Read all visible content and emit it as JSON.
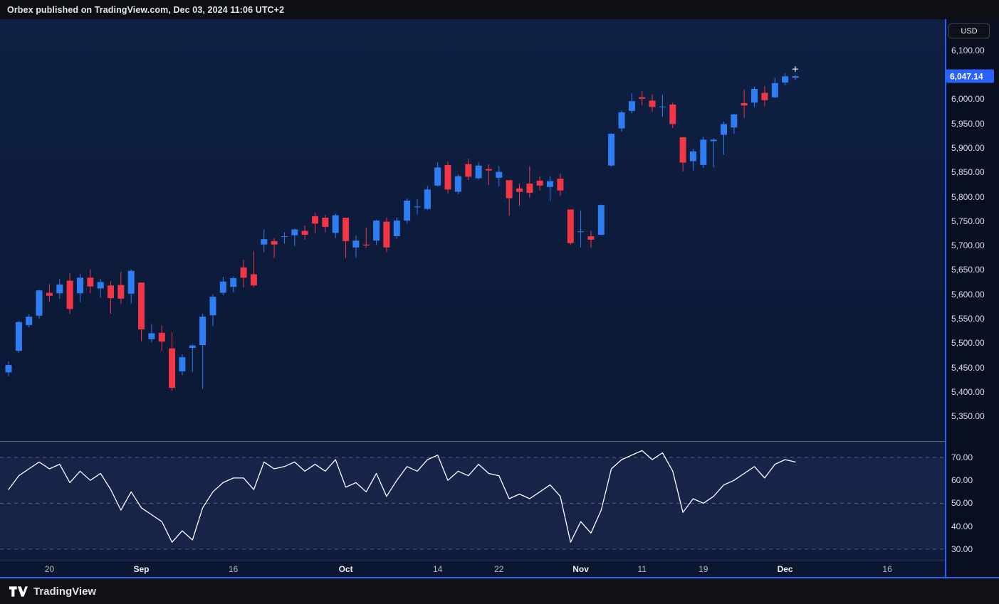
{
  "banner": {
    "text": "Orbex published on TradingView.com, Dec 03, 2024 11:06 UTC+2"
  },
  "footer": {
    "brand": "TradingView"
  },
  "price_axis": {
    "currency_label": "USD",
    "last_price_badge": "6,047.14"
  },
  "time_axis": {
    "ticks": [
      {
        "label": "20",
        "index": 4,
        "major": false
      },
      {
        "label": "Sep",
        "index": 13,
        "major": true
      },
      {
        "label": "16",
        "index": 22,
        "major": false
      },
      {
        "label": "Oct",
        "index": 33,
        "major": true
      },
      {
        "label": "14",
        "index": 42,
        "major": false
      },
      {
        "label": "22",
        "index": 48,
        "major": false
      },
      {
        "label": "Nov",
        "index": 56,
        "major": true
      },
      {
        "label": "11",
        "index": 62,
        "major": false
      },
      {
        "label": "19",
        "index": 68,
        "major": false
      },
      {
        "label": "Dec",
        "index": 76,
        "major": true
      },
      {
        "label": "16",
        "index": 86,
        "major": false
      }
    ]
  },
  "colors": {
    "up": "#2f7df2",
    "down": "#f23645",
    "accent": "#2962ff",
    "rsi_line": "#ffffff",
    "background": "#0c1a38"
  },
  "chart_data": [
    {
      "type": "candlestick",
      "name": "price",
      "currency": "USD",
      "last_price": 6047.14,
      "y_range": [
        5299,
        6164
      ],
      "y_axis_ticks": [
        {
          "label": "6,100.00",
          "value": 6100
        },
        {
          "label": "6,000.00",
          "value": 6000
        },
        {
          "label": "5,950.00",
          "value": 5950
        },
        {
          "label": "5,900.00",
          "value": 5900
        },
        {
          "label": "5,850.00",
          "value": 5850
        },
        {
          "label": "5,800.00",
          "value": 5800
        },
        {
          "label": "5,750.00",
          "value": 5750
        },
        {
          "label": "5,700.00",
          "value": 5700
        },
        {
          "label": "5,650.00",
          "value": 5650
        },
        {
          "label": "5,600.00",
          "value": 5600
        },
        {
          "label": "5,550.00",
          "value": 5550
        },
        {
          "label": "5,500.00",
          "value": 5500
        },
        {
          "label": "5,450.00",
          "value": 5450
        },
        {
          "label": "5,400.00",
          "value": 5400
        },
        {
          "label": "5,350.00",
          "value": 5350
        }
      ],
      "candles": [
        [
          5440,
          5462,
          5432,
          5455
        ],
        [
          5484,
          5545,
          5480,
          5543
        ],
        [
          5537,
          5559,
          5532,
          5554
        ],
        [
          5556,
          5609,
          5550,
          5608
        ],
        [
          5603,
          5621,
          5585,
          5597
        ],
        [
          5602,
          5632,
          5591,
          5620
        ],
        [
          5628,
          5643,
          5560,
          5570
        ],
        [
          5602,
          5642,
          5584,
          5634
        ],
        [
          5634,
          5651,
          5602,
          5616
        ],
        [
          5612,
          5632,
          5593,
          5625
        ],
        [
          5618,
          5627,
          5560,
          5592
        ],
        [
          5619,
          5646,
          5581,
          5591
        ],
        [
          5601,
          5651,
          5581,
          5648
        ],
        [
          5624,
          5624,
          5504,
          5528
        ],
        [
          5508,
          5539,
          5502,
          5520
        ],
        [
          5521,
          5537,
          5484,
          5503
        ],
        [
          5489,
          5523,
          5402,
          5408
        ],
        [
          5442,
          5477,
          5434,
          5471
        ],
        [
          5490,
          5497,
          5441,
          5495
        ],
        [
          5496,
          5560,
          5406,
          5554
        ],
        [
          5557,
          5600,
          5535,
          5595
        ],
        [
          5603,
          5636,
          5598,
          5626
        ],
        [
          5615,
          5636,
          5604,
          5633
        ],
        [
          5655,
          5671,
          5614,
          5634
        ],
        [
          5641,
          5689,
          5615,
          5618
        ],
        [
          5702,
          5733,
          5686,
          5713
        ],
        [
          5709,
          5715,
          5674,
          5702
        ],
        [
          5718,
          5727,
          5704,
          5719
        ],
        [
          5721,
          5735,
          5699,
          5733
        ],
        [
          5730,
          5741,
          5712,
          5722
        ],
        [
          5760,
          5767,
          5725,
          5745
        ],
        [
          5757,
          5763,
          5727,
          5738
        ],
        [
          5726,
          5765,
          5715,
          5762
        ],
        [
          5757,
          5757,
          5674,
          5709
        ],
        [
          5696,
          5720,
          5675,
          5710
        ],
        [
          5702,
          5737,
          5695,
          5700
        ],
        [
          5710,
          5753,
          5701,
          5751
        ],
        [
          5749,
          5757,
          5686,
          5696
        ],
        [
          5719,
          5757,
          5714,
          5751
        ],
        [
          5751,
          5796,
          5745,
          5792
        ],
        [
          5779,
          5795,
          5764,
          5780
        ],
        [
          5775,
          5822,
          5773,
          5815
        ],
        [
          5823,
          5871,
          5821,
          5860
        ],
        [
          5865,
          5872,
          5806,
          5815
        ],
        [
          5810,
          5846,
          5805,
          5842
        ],
        [
          5867,
          5878,
          5834,
          5841
        ],
        [
          5838,
          5870,
          5835,
          5864
        ],
        [
          5857,
          5866,
          5824,
          5854
        ],
        [
          5839,
          5863,
          5821,
          5851
        ],
        [
          5834,
          5834,
          5761,
          5797
        ],
        [
          5817,
          5827,
          5781,
          5810
        ],
        [
          5827,
          5862,
          5798,
          5808
        ],
        [
          5833,
          5842,
          5813,
          5823
        ],
        [
          5820,
          5842,
          5791,
          5832
        ],
        [
          5837,
          5847,
          5802,
          5813
        ],
        [
          5774,
          5774,
          5701,
          5705
        ],
        [
          5728,
          5772,
          5696,
          5729
        ],
        [
          5719,
          5730,
          5695,
          5712
        ],
        [
          5722,
          5784,
          5721,
          5783
        ],
        [
          5864,
          5930,
          5862,
          5929
        ],
        [
          5940,
          5976,
          5934,
          5973
        ],
        [
          5976,
          6012,
          5971,
          5996
        ],
        [
          6004,
          6017,
          5987,
          6001
        ],
        [
          5997,
          6010,
          5974,
          5984
        ],
        [
          5985,
          6009,
          5964,
          5985
        ],
        [
          5989,
          5993,
          5941,
          5949
        ],
        [
          5922,
          5922,
          5852,
          5870
        ],
        [
          5873,
          5898,
          5854,
          5893
        ],
        [
          5865,
          5923,
          5859,
          5917
        ],
        [
          5914,
          5920,
          5860,
          5917
        ],
        [
          5927,
          5954,
          5886,
          5949
        ],
        [
          5942,
          5970,
          5929,
          5969
        ],
        [
          5992,
          6020,
          5962,
          5987
        ],
        [
          5993,
          6026,
          5984,
          6021
        ],
        [
          6013,
          6027,
          5985,
          5998
        ],
        [
          6004,
          6044,
          6002,
          6033
        ],
        [
          6034,
          6053,
          6028,
          6047
        ],
        [
          6044,
          6050,
          6040,
          6047.14
        ]
      ]
    },
    {
      "type": "line",
      "name": "RSI",
      "y_range": [
        25,
        76.8
      ],
      "levels": [
        70,
        50,
        30
      ],
      "y_axis_ticks": [
        {
          "label": "70.00",
          "value": 70
        },
        {
          "label": "60.00",
          "value": 60
        },
        {
          "label": "50.00",
          "value": 50
        },
        {
          "label": "40.00",
          "value": 40
        },
        {
          "label": "30.00",
          "value": 30
        }
      ],
      "values": [
        56,
        62,
        65,
        68,
        65,
        67,
        59,
        64,
        60,
        63,
        56,
        47,
        55,
        48,
        45,
        42,
        33,
        38,
        34,
        48,
        55,
        59,
        61,
        61,
        56,
        68,
        65,
        66,
        68,
        64,
        67,
        64,
        69,
        57,
        59,
        55,
        63,
        53,
        60,
        66,
        64,
        69,
        71,
        60,
        64,
        62,
        67,
        63,
        62,
        52,
        54,
        52,
        55,
        58,
        53,
        33,
        42,
        37,
        47,
        65,
        69,
        71,
        73,
        69,
        72,
        64,
        46,
        52,
        50,
        53,
        58,
        60,
        63,
        66,
        61,
        67,
        69,
        68
      ]
    }
  ]
}
